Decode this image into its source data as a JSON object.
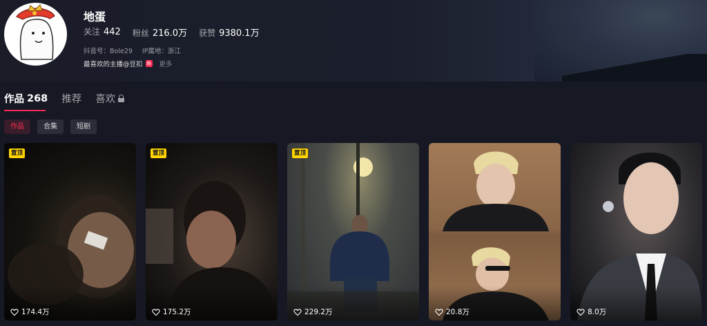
{
  "profile": {
    "name": "地蛋",
    "stats": [
      {
        "label": "关注",
        "value": "442"
      },
      {
        "label": "粉丝",
        "value": "216.0万"
      },
      {
        "label": "获赞",
        "value": "9380.1万"
      }
    ],
    "douyin_id": "抖音号：Bole29",
    "ip_location": "IP属地：浙江",
    "bio": "最喜欢的主播@豆扣",
    "bio_badge": "命",
    "more_label": "更多"
  },
  "tabs": [
    {
      "label": "作品",
      "count": "268",
      "active": true
    },
    {
      "label": "推荐",
      "active": false
    },
    {
      "label": "喜欢",
      "active": false,
      "icon": "lock-icon"
    }
  ],
  "chips": [
    {
      "label": "作品",
      "active": true
    },
    {
      "label": "合集",
      "active": false
    },
    {
      "label": "短剧",
      "active": false
    }
  ],
  "videos": [
    {
      "pinned": true,
      "pin_label": "置顶",
      "likes": "174.4万"
    },
    {
      "pinned": true,
      "pin_label": "置顶",
      "likes": "175.2万"
    },
    {
      "pinned": true,
      "pin_label": "置顶",
      "likes": "229.2万"
    },
    {
      "pinned": false,
      "likes": "20.8万"
    },
    {
      "pinned": false,
      "likes": "8.0万"
    }
  ],
  "colors": {
    "accent": "#fe2c55",
    "background": "#161823",
    "pin": "#ffd400"
  }
}
